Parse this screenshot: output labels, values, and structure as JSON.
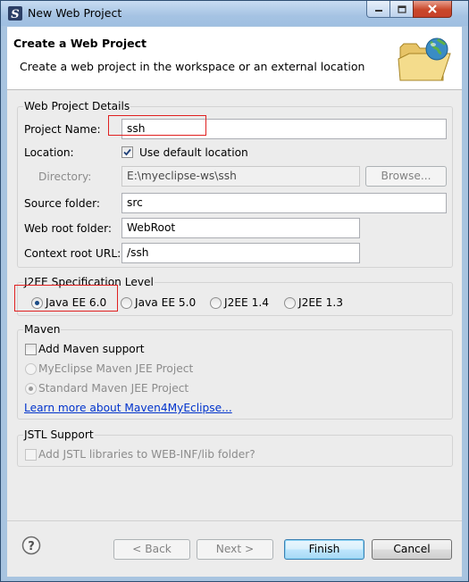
{
  "window": {
    "title": "New Web Project",
    "controls": {
      "minimize": "minimize-icon",
      "maximize": "maximize-icon",
      "close": "close-icon"
    }
  },
  "header": {
    "title": "Create a Web Project",
    "description": "Create a web project in the workspace or an external location",
    "icon": "folder-globe-icon"
  },
  "details": {
    "group_label": "Web Project Details",
    "project_name_label": "Project Name:",
    "project_name_value": "ssh",
    "location_label": "Location:",
    "use_default_label": "Use default location",
    "use_default_checked": true,
    "directory_label": "Directory:",
    "directory_value": "E:\\myeclipse-ws\\ssh",
    "browse_label": "Browse...",
    "source_folder_label": "Source folder:",
    "source_folder_value": "src",
    "web_root_label": "Web root folder:",
    "web_root_value": "WebRoot",
    "context_root_label": "Context root URL:",
    "context_root_value": "/ssh"
  },
  "j2ee": {
    "group_label": "J2EE Specification Level",
    "options": [
      "Java EE 6.0",
      "Java EE 5.0",
      "J2EE 1.4",
      "J2EE 1.3"
    ],
    "selected": "Java EE 6.0"
  },
  "maven": {
    "group_label": "Maven",
    "add_support_label": "Add Maven support",
    "add_support_checked": false,
    "option1": "MyEclipse Maven JEE Project",
    "option2": "Standard Maven JEE Project",
    "selected": "Standard Maven JEE Project",
    "learn_more": "Learn more about Maven4MyEclipse..."
  },
  "jstl": {
    "group_label": "JSTL Support",
    "add_label": "Add JSTL libraries to WEB-INF/lib folder?",
    "checked": false
  },
  "footer": {
    "help_icon": "help-icon",
    "back_label": "< Back",
    "next_label": "Next >",
    "finish_label": "Finish",
    "cancel_label": "Cancel"
  },
  "colors": {
    "title_bar": "#a8c4e0",
    "close_button": "#c9472a",
    "highlight_box": "#e02020",
    "link": "#0033cc"
  }
}
